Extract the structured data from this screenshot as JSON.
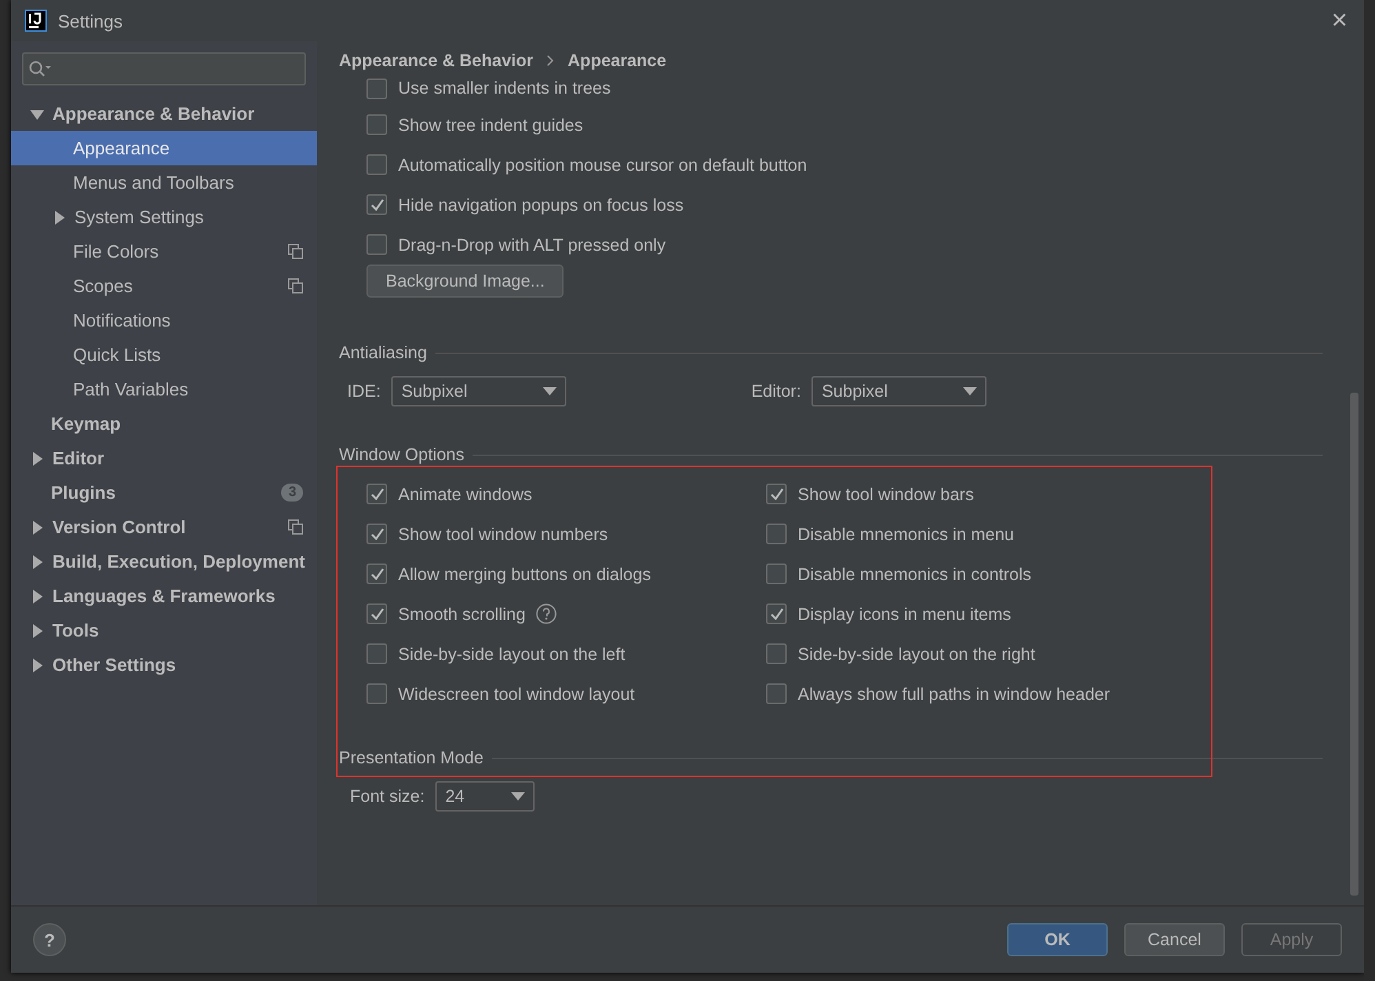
{
  "window": {
    "title": "Settings",
    "close": "×"
  },
  "sidebar": {
    "items": [
      {
        "label": "Appearance & Behavior",
        "expanded": true,
        "selected": false,
        "project_icon": false,
        "children": [
          {
            "label": "Appearance",
            "selected": true,
            "project_icon": false
          },
          {
            "label": "Menus and Toolbars",
            "selected": false,
            "project_icon": false
          },
          {
            "label": "System Settings",
            "selected": false,
            "expanded": false,
            "project_icon": false
          },
          {
            "label": "File Colors",
            "selected": false,
            "project_icon": true
          },
          {
            "label": "Scopes",
            "selected": false,
            "project_icon": true
          },
          {
            "label": "Notifications",
            "selected": false,
            "project_icon": false
          },
          {
            "label": "Quick Lists",
            "selected": false,
            "project_icon": false
          },
          {
            "label": "Path Variables",
            "selected": false,
            "project_icon": false
          }
        ]
      },
      {
        "label": "Keymap",
        "selected": false,
        "project_icon": false
      },
      {
        "label": "Editor",
        "expanded": false,
        "selected": false,
        "project_icon": false
      },
      {
        "label": "Plugins",
        "selected": false,
        "badge": "3",
        "project_icon": false
      },
      {
        "label": "Version Control",
        "expanded": false,
        "selected": false,
        "project_icon": true
      },
      {
        "label": "Build, Execution, Deployment",
        "expanded": false,
        "selected": false,
        "project_icon": false
      },
      {
        "label": "Languages & Frameworks",
        "expanded": false,
        "selected": false,
        "project_icon": false
      },
      {
        "label": "Tools",
        "expanded": false,
        "selected": false,
        "project_icon": false
      },
      {
        "label": "Other Settings",
        "expanded": false,
        "selected": false,
        "project_icon": false
      }
    ]
  },
  "breadcrumb": [
    "Appearance & Behavior",
    "Appearance"
  ],
  "top_options": [
    {
      "kind": "checkbox",
      "label": "Use smaller indents in trees",
      "checked": false
    },
    {
      "kind": "checkbox",
      "label": "Show tree indent guides",
      "checked": false
    },
    {
      "kind": "checkbox",
      "label": "Automatically position mouse cursor on default button",
      "checked": false
    },
    {
      "kind": "checkbox",
      "label": "Hide navigation popups on focus loss",
      "checked": true
    },
    {
      "kind": "checkbox",
      "label": "Drag-n-Drop with ALT pressed only",
      "checked": false
    },
    {
      "kind": "button",
      "label": "Background Image..."
    }
  ],
  "antialiasing": {
    "title": "Antialiasing",
    "fields": [
      {
        "label": "IDE:",
        "value": "Subpixel"
      },
      {
        "label": "Editor:",
        "value": "Subpixel"
      }
    ]
  },
  "window_options": {
    "title": "Window Options",
    "columns": [
      [
        {
          "label": "Animate windows",
          "checked": true
        },
        {
          "label": "Show tool window numbers",
          "checked": true
        },
        {
          "label": "Allow merging buttons on dialogs",
          "checked": true
        },
        {
          "label": "Smooth scrolling",
          "checked": true,
          "help": true
        },
        {
          "label": "Side-by-side layout on the left",
          "checked": false
        },
        {
          "label": "Widescreen tool window layout",
          "checked": false
        }
      ],
      [
        {
          "label": "Show tool window bars",
          "checked": true
        },
        {
          "label": "Disable mnemonics in menu",
          "checked": false
        },
        {
          "label": "Disable mnemonics in controls",
          "checked": false
        },
        {
          "label": "Display icons in menu items",
          "checked": true
        },
        {
          "label": "Side-by-side layout on the right",
          "checked": false
        },
        {
          "label": "Always show full paths in window header",
          "checked": false
        }
      ]
    ]
  },
  "presentation_mode": {
    "title": "Presentation Mode",
    "font_size": {
      "label": "Font size:",
      "value": "24"
    }
  },
  "footer": {
    "help": "?",
    "buttons": [
      {
        "label": "OK",
        "kind": "primary",
        "disabled": false
      },
      {
        "label": "Cancel",
        "kind": "normal",
        "disabled": false
      },
      {
        "label": "Apply",
        "kind": "normal",
        "disabled": true
      }
    ]
  }
}
